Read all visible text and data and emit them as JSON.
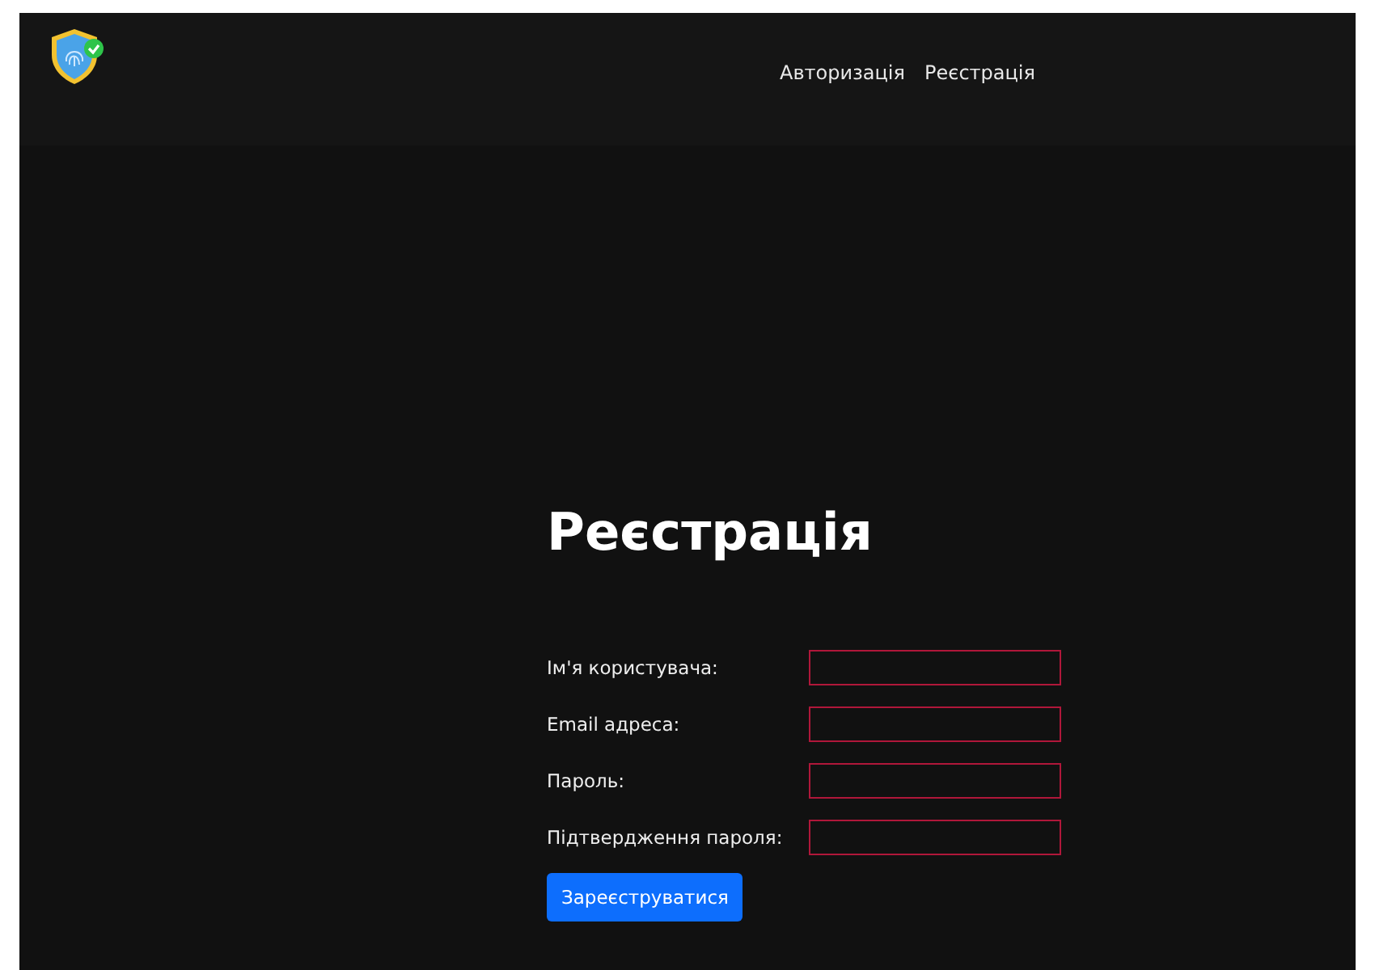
{
  "nav": {
    "links": [
      {
        "label": "Авторизація",
        "selected": false
      },
      {
        "label": "Реєстрація",
        "selected": false
      }
    ]
  },
  "form": {
    "title": "Реєстрація",
    "fields": [
      {
        "label": "Ім'я користувача:",
        "invalid": true
      },
      {
        "label": "Email адреса:",
        "invalid": true
      },
      {
        "label": "Пароль:",
        "invalid": true
      },
      {
        "label": "Підтвердження пароля:",
        "invalid": true
      }
    ],
    "submit": "Зареєструватися"
  }
}
